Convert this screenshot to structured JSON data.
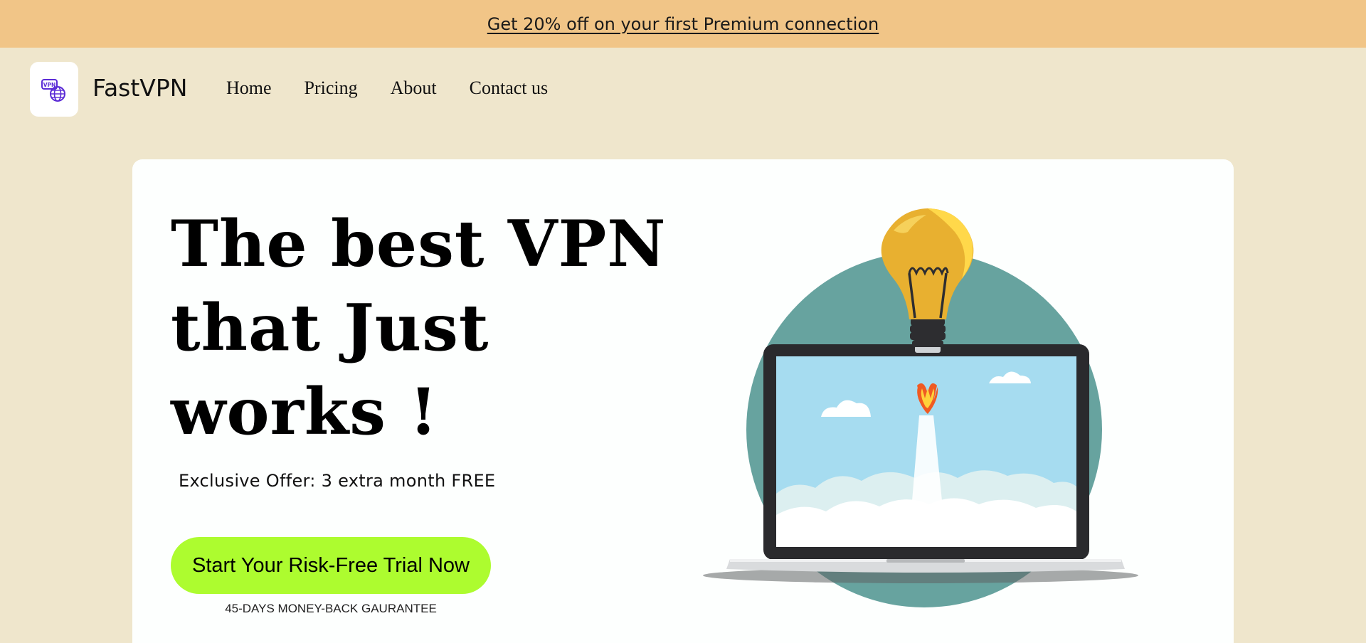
{
  "promo": {
    "text": "Get 20% off on your first Premium connection"
  },
  "header": {
    "logo_text": "VPN",
    "brand": "FastVPN",
    "nav": [
      {
        "label": "Home"
      },
      {
        "label": "Pricing"
      },
      {
        "label": "About"
      },
      {
        "label": "Contact us"
      }
    ]
  },
  "hero": {
    "title_lines": [
      "The best VPN",
      "that Just",
      "works !"
    ],
    "offer": "Exclusive Offer: 3 extra month FREE",
    "cta_label": "Start Your Risk-Free Trial Now",
    "guarantee": "45-DAYS MONEY-BACK GAURANTEE"
  },
  "colors": {
    "promo_bg": "#f1c587",
    "page_bg": "#efe6cc",
    "cta_bg": "#adfc2f",
    "accent_purple": "#5b2bd6",
    "illustration_circle": "#67a39f",
    "screen_sky": "#a6dcf0",
    "bulb_yellow": "#e8b030"
  },
  "icons": {
    "logo": "vpn-globe-icon",
    "illustration": "laptop-rocket-lightbulb"
  }
}
